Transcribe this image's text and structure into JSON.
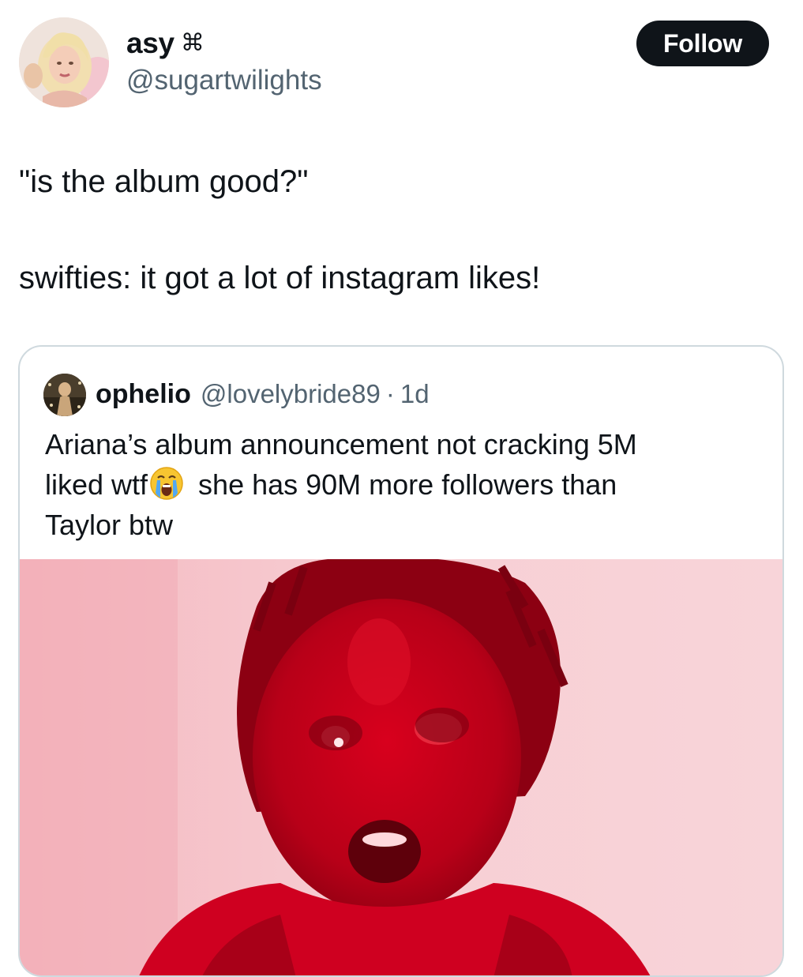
{
  "author": {
    "display_name": "asy",
    "name_glyph": "⌘",
    "handle": "@sugartwilights",
    "avatar": "profile-photo"
  },
  "actions": {
    "follow_label": "Follow"
  },
  "tweet": {
    "lines": [
      "\"is the album good?\"",
      "swifties: it got a lot of instagram likes!"
    ]
  },
  "quoted_tweet": {
    "display_name": "ophelio",
    "handle": "@lovelybride89",
    "separator": "·",
    "time": "1d",
    "text_lines": [
      "Ariana’s album announcement not cracking 5M",
      "liked wtf",
      " she has 90M more followers than",
      "Taylor btw"
    ],
    "emoji": "loudly-crying-face",
    "media": "red-tinted-reaction-image"
  },
  "colors": {
    "text_primary": "#0f1419",
    "text_secondary": "#536471",
    "border": "#cfd9de",
    "follow_bg": "#0f1419",
    "media_pink": "#f6c9cf",
    "media_red": "#c5001a"
  }
}
